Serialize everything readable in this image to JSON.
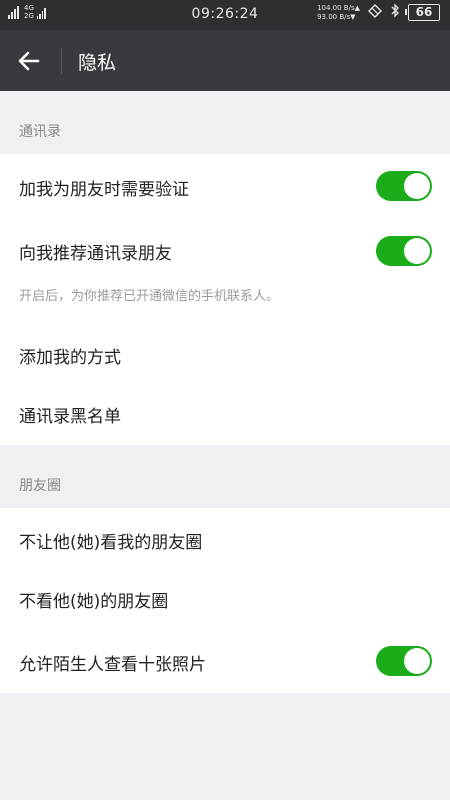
{
  "status_bar": {
    "network_top": "4G",
    "network_bottom": "2G",
    "time": "09:26:24",
    "speed_up": "104.00 B/s▲",
    "speed_down": "93.00 B/s▼",
    "battery": "66"
  },
  "header": {
    "title": "隐私"
  },
  "sections": {
    "contacts": {
      "title": "通讯录",
      "items": [
        {
          "label": "加我为朋友时需要验证",
          "toggle_on": true
        },
        {
          "label": "向我推荐通讯录朋友",
          "toggle_on": true,
          "description": "开启后，为你推荐已开通微信的手机联系人。"
        },
        {
          "label": "添加我的方式"
        },
        {
          "label": "通讯录黑名单"
        }
      ]
    },
    "moments": {
      "title": "朋友圈",
      "items": [
        {
          "label": "不让他(她)看我的朋友圈"
        },
        {
          "label": "不看他(她)的朋友圈"
        },
        {
          "label": "允许陌生人查看十张照片",
          "toggle_on": true
        }
      ]
    }
  },
  "colors": {
    "toggle_on": "#1aad19",
    "header_bg": "#393a3f",
    "status_bg": "#2e2f33",
    "page_bg": "#efeff4"
  }
}
